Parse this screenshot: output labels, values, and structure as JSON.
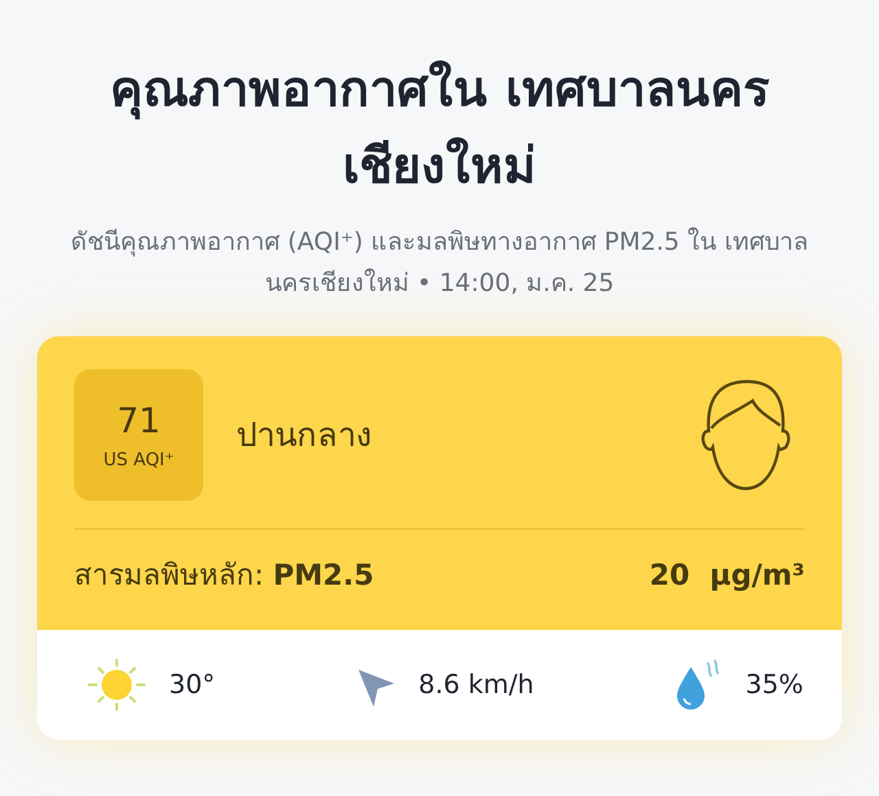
{
  "title": "คุณภาพอากาศใน เทศบาลนครเชียงใหม่",
  "subtitle": "ดัชนีคุณภาพอากาศ (AQI⁺) และมลพิษทางอากาศ PM2.5 ใน เทศบาลนครเชียงใหม่ • 14:00, ม.ค. 25",
  "aqi": {
    "value": "71",
    "unit": "US AQI⁺",
    "level_label": "ปานกลาง"
  },
  "pollutant": {
    "label": "สารมลพิษหลัก:",
    "name": "PM2.5",
    "value": "20",
    "unit": "µg/m³"
  },
  "weather": [
    {
      "kind": "temperature",
      "text": "30°"
    },
    {
      "kind": "wind",
      "text": "8.6 km/h"
    },
    {
      "kind": "humidity",
      "text": "35%"
    }
  ]
}
